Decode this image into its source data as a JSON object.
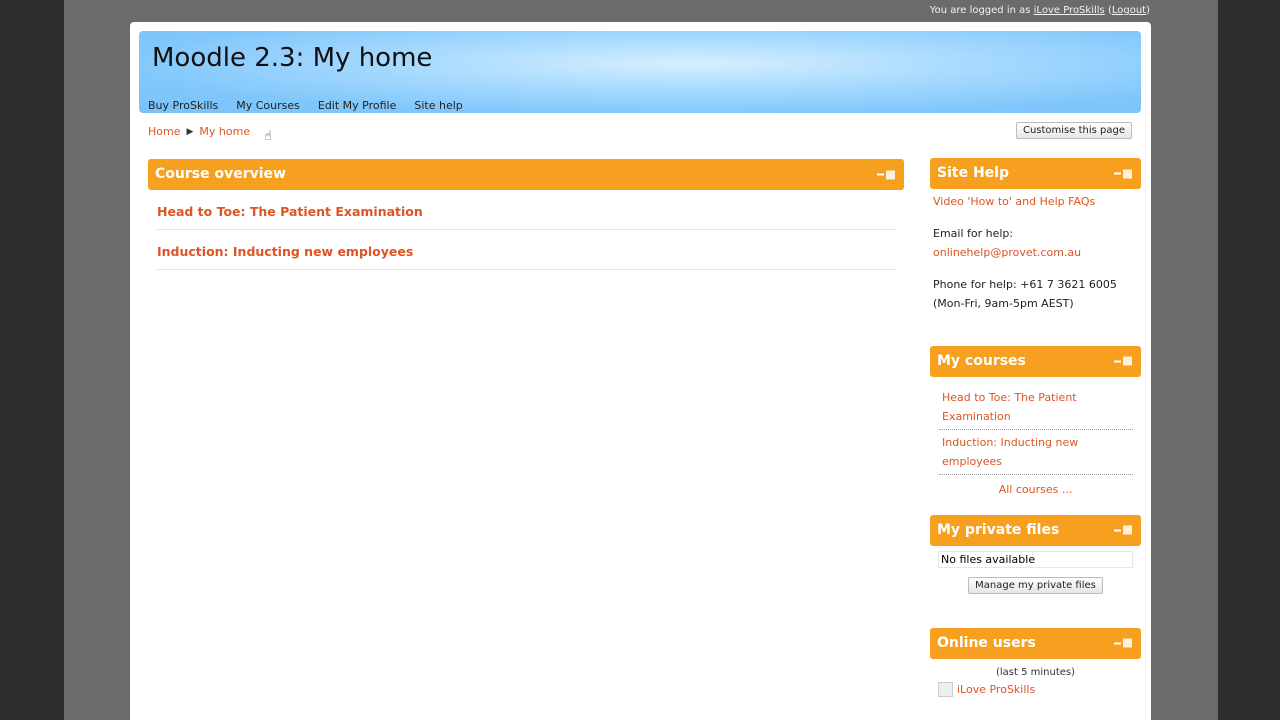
{
  "login": {
    "prefix": "You are logged in as",
    "user": "iLove ProSkills",
    "open_paren": "(",
    "logout": "Logout",
    "close_paren": ")"
  },
  "header": {
    "title": "Moodle 2.3: My home",
    "menu": [
      "Buy ProSkills",
      "My Courses",
      "Edit My Profile",
      "Site help"
    ]
  },
  "breadcrumb": {
    "home": "Home",
    "separator": "▶",
    "current": "My home"
  },
  "customise_button": "Customise this page",
  "course_overview": {
    "title": "Course overview",
    "courses": [
      "Head to Toe: The Patient Examination",
      "Induction: Inducting new employees"
    ]
  },
  "site_help": {
    "title": "Site Help",
    "video_link": "Video 'How to' and Help FAQs",
    "email_label": "Email for help:",
    "email": "onlinehelp@provet.com.au",
    "phone_line": "Phone for help: +61 7 3621 6005",
    "hours": "(Mon-Fri, 9am-5pm AEST)"
  },
  "my_courses": {
    "title": "My courses",
    "items": [
      "Head to Toe: The Patient Examination",
      "Induction: Inducting new employees"
    ],
    "all_courses": "All courses ..."
  },
  "private_files": {
    "title": "My private files",
    "empty": "No files available",
    "manage_button": "Manage my private files"
  },
  "online_users": {
    "title": "Online users",
    "period": "(last 5 minutes)",
    "users": [
      "iLove ProSkills"
    ]
  },
  "colors": {
    "accent_orange": "#f7a020",
    "link": "#dd5522",
    "header_blue": "#7fc6fb"
  }
}
